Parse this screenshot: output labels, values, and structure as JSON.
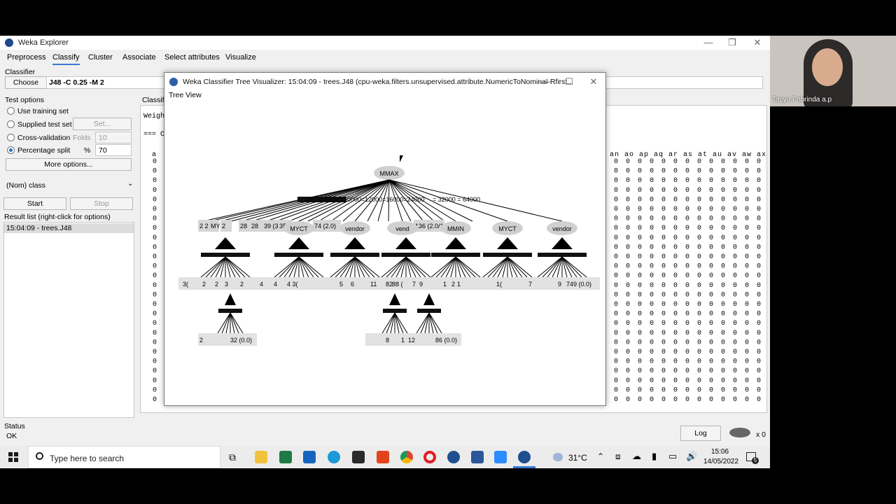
{
  "explorer": {
    "title": "Weka Explorer",
    "tabs": [
      "Preprocess",
      "Classify",
      "Cluster",
      "Associate",
      "Select attributes",
      "Visualize"
    ],
    "classifier_label": "Classifier",
    "choose_label": "Choose",
    "classifier_value": "J48 -C 0.25 -M 2",
    "test_options_label": "Test options",
    "options": [
      {
        "label": "Use training set"
      },
      {
        "label": "Supplied test set",
        "button": "Set..."
      },
      {
        "label": "Cross-validation",
        "field_label": "Folds",
        "value": "10"
      },
      {
        "label": "Percentage split",
        "field_label": "%",
        "value": "70"
      }
    ],
    "more_options": "More options...",
    "class_select": "(Nom) class",
    "start": "Start",
    "stop": "Stop",
    "result_list_label": "Result list (right-click for options)",
    "result_item": "15:04:09 - trees.J48",
    "output_label": "Classifi",
    "output_line1": "Weigh",
    "output_line2": "=== C",
    "col_header_left": "a",
    "col_header_right": "an ao ap aq ar as at au av aw ax ay az",
    "status_label": "Status",
    "status_value": "OK",
    "log_button": "Log",
    "bird_count": "x 0"
  },
  "visualizer": {
    "title": "Weka Classifier Tree Visualizer: 15:04:09 - trees.J48 (cpu-weka.filters.unsupervised.attribute.NumericToNominal-Rfirst...",
    "menu": "Tree View",
    "root": "MMAX",
    "edge_label": "= 32000 = 64000",
    "edge_label_left": "=6000=8000=10000=12000=16000=24000",
    "level1_nodes": [
      {
        "label": "MYCT",
        "kind": "node"
      },
      {
        "label": "vendor",
        "kind": "node"
      },
      {
        "label": "vend",
        "kind": "node"
      },
      {
        "label": "MMIN",
        "kind": "node"
      },
      {
        "label": "MYCT",
        "kind": "node"
      },
      {
        "label": "vendor",
        "kind": "node"
      }
    ],
    "level1_leaves": [
      "2 2",
      "MY",
      "2",
      "28",
      "28",
      "39 (3",
      "35",
      "74 (2.0)",
      "136 (2.0/1"
    ],
    "level2_leaves": [
      "3(",
      "2",
      "2",
      "3",
      "2",
      "4",
      "4",
      "4 3(",
      "5",
      "6",
      "11",
      "82",
      "88 (",
      "7",
      "9",
      "1",
      "2",
      "1",
      "1(",
      "7",
      "9",
      "749 (0.0)"
    ],
    "level3_leaves": [
      "2",
      "32 (0.0)",
      "8",
      "1",
      "12",
      "86 (0.0)"
    ]
  },
  "webcam": {
    "name": "Tasya Febrinda a.p"
  },
  "taskbar": {
    "search_placeholder": "Type here to search",
    "temperature": "31°C",
    "time": "15:06",
    "date": "14/05/2022",
    "notification_count": "5"
  }
}
